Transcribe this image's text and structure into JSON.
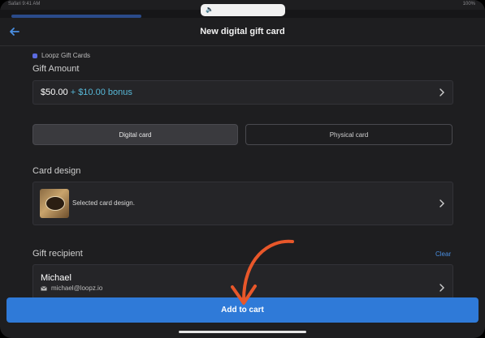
{
  "statusbar": {
    "left": "Safari 9:41 AM",
    "right": "100%"
  },
  "volume": {
    "icon": "speaker-icon",
    "glyph": "🔈"
  },
  "header": {
    "title": "New digital gift card",
    "back_icon": "arrow-left-icon"
  },
  "merchant": {
    "name": "Loopz Gift Cards"
  },
  "gift_amount": {
    "label": "Gift Amount",
    "amount": "$50.00",
    "bonus": " + $10.00 bonus"
  },
  "card_type": {
    "options": [
      "Digital card",
      "Physical card"
    ],
    "selected": "Digital card"
  },
  "card_design": {
    "label": "Card design",
    "description": "Selected card design."
  },
  "recipient": {
    "label": "Gift recipient",
    "clear": "Clear",
    "name": "Michael",
    "email": "michael@loopz.io"
  },
  "actions": {
    "add_to_cart": "Add to cart"
  },
  "colors": {
    "accent": "#2f7ad8",
    "bonus": "#57b8d8",
    "annotation": "#e8572a",
    "background": "#1e1e20"
  }
}
